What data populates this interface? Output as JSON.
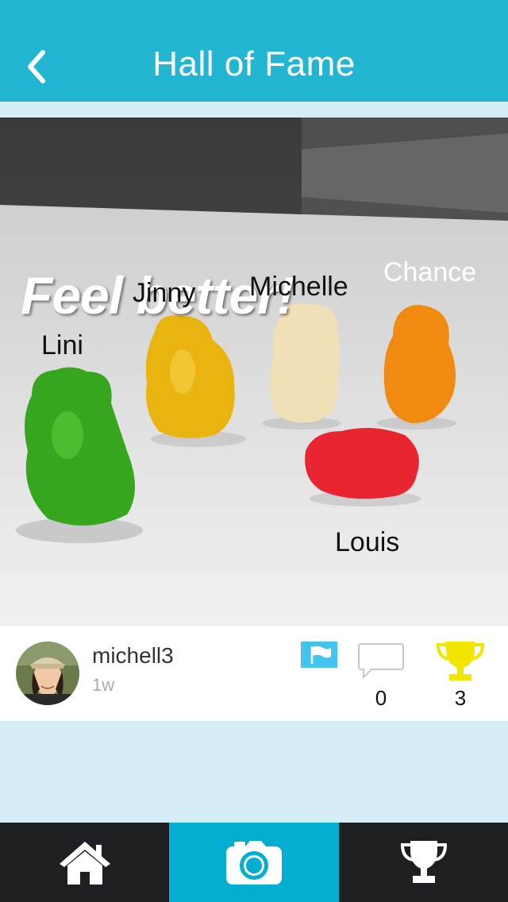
{
  "header": {
    "title": "Hall of Fame",
    "back_icon": "chevron-left-icon"
  },
  "photo": {
    "caption": "Feel better!",
    "names": [
      "Lini",
      "Jinny",
      "Michelle",
      "Chance",
      "Louis"
    ]
  },
  "post": {
    "username": "michell3",
    "time_ago": "1w",
    "comment_count": "0",
    "trophy_count": "3",
    "flag_icon": "flag-icon",
    "comment_icon": "speech-bubble-icon",
    "trophy_icon": "trophy-icon"
  },
  "tabs": [
    {
      "name": "home",
      "icon": "home-icon"
    },
    {
      "name": "camera",
      "icon": "camera-icon",
      "active": true
    },
    {
      "name": "hall-of-fame",
      "icon": "trophy-icon"
    }
  ],
  "colors": {
    "accent": "#23b6d3",
    "tab_active": "#03aed0",
    "tabbar": "#1e1f22",
    "page_bg": "#d5eef6",
    "trophy": "#f2e600",
    "flag": "#43c4ee"
  }
}
